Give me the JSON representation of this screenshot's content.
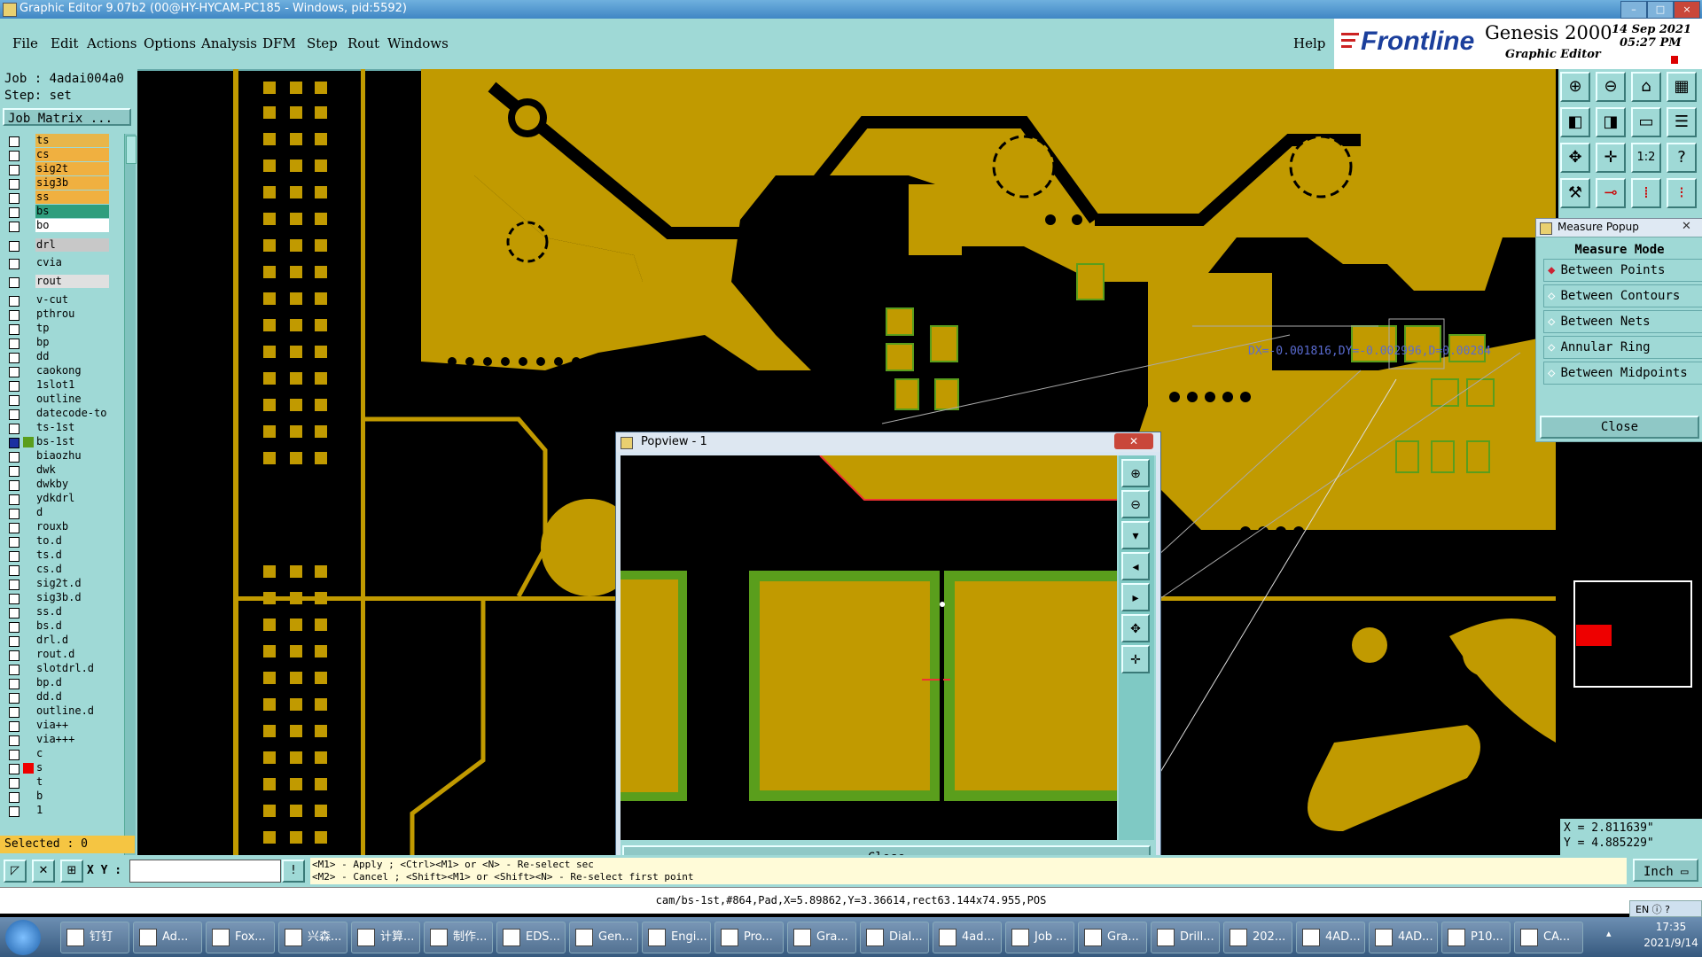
{
  "window": {
    "title": "Graphic Editor 9.07b2 (00@HY-HYCAM-PC185 - Windows, pid:5592)"
  },
  "menu": {
    "items": [
      "File",
      "Edit",
      "Actions",
      "Options",
      "Analysis",
      "DFM",
      "Step",
      "Rout",
      "Windows"
    ],
    "help": "Help"
  },
  "brand": {
    "logo": "Frontline",
    "product": "Genesis 2000",
    "subtitle": "Graphic Editor",
    "date": "14 Sep 2021",
    "time": "05:27 PM"
  },
  "job": {
    "job_line": "Job : 4adai004a0",
    "step_line": "Step: set",
    "matrix_button": "Job Matrix ..."
  },
  "layers": [
    {
      "name": "ts",
      "color": "#e8b64a"
    },
    {
      "name": "cs",
      "color": "#f0b040"
    },
    {
      "name": "sig2t",
      "color": "#f0b040"
    },
    {
      "name": "sig3b",
      "color": "#f0b040"
    },
    {
      "name": "ss",
      "color": "#f0b040"
    },
    {
      "name": "bs",
      "color": "#2e9e7e"
    },
    {
      "name": "bo",
      "color": "#ffffff"
    },
    {
      "name": "drl",
      "color": "#c8c8c8"
    },
    {
      "name": "cvia",
      "color": "#9fd9d6"
    },
    {
      "name": "rout",
      "color": "#e0e0e0"
    },
    {
      "name": "v-cut",
      "color": "#9fd9d6"
    },
    {
      "name": "pthrou",
      "color": "#9fd9d6"
    },
    {
      "name": "tp",
      "color": "#9fd9d6"
    },
    {
      "name": "bp",
      "color": "#9fd9d6"
    },
    {
      "name": "dd",
      "color": "#9fd9d6"
    },
    {
      "name": "caokong",
      "color": "#9fd9d6"
    },
    {
      "name": "1slot1",
      "color": "#9fd9d6"
    },
    {
      "name": "outline",
      "color": "#9fd9d6"
    },
    {
      "name": "datecode-to",
      "color": "#9fd9d6"
    },
    {
      "name": "ts-1st",
      "color": "#9fd9d6"
    },
    {
      "name": "bs-1st",
      "color": "#9fd9d6"
    },
    {
      "name": "biaozhu",
      "color": "#9fd9d6"
    },
    {
      "name": "dwk",
      "color": "#9fd9d6"
    },
    {
      "name": "dwkby",
      "color": "#9fd9d6"
    },
    {
      "name": "ydkdrl",
      "color": "#9fd9d6"
    },
    {
      "name": "d",
      "color": "#9fd9d6"
    },
    {
      "name": "rouxb",
      "color": "#9fd9d6"
    },
    {
      "name": "to.d",
      "color": "#9fd9d6"
    },
    {
      "name": "ts.d",
      "color": "#9fd9d6"
    },
    {
      "name": "cs.d",
      "color": "#9fd9d6"
    },
    {
      "name": "sig2t.d",
      "color": "#9fd9d6"
    },
    {
      "name": "sig3b.d",
      "color": "#9fd9d6"
    },
    {
      "name": "ss.d",
      "color": "#9fd9d6"
    },
    {
      "name": "bs.d",
      "color": "#9fd9d6"
    },
    {
      "name": "drl.d",
      "color": "#9fd9d6"
    },
    {
      "name": "rout.d",
      "color": "#9fd9d6"
    },
    {
      "name": "slotdrl.d",
      "color": "#9fd9d6"
    },
    {
      "name": "bp.d",
      "color": "#9fd9d6"
    },
    {
      "name": "dd.d",
      "color": "#9fd9d6"
    },
    {
      "name": "outline.d",
      "color": "#9fd9d6"
    },
    {
      "name": "via++",
      "color": "#9fd9d6"
    },
    {
      "name": "via+++",
      "color": "#9fd9d6"
    },
    {
      "name": "c",
      "color": "#9fd9d6"
    },
    {
      "name": "s",
      "color": "#9fd9d6"
    },
    {
      "name": "t",
      "color": "#9fd9d6"
    },
    {
      "name": "b",
      "color": "#9fd9d6"
    },
    {
      "name": "1",
      "color": "#9fd9d6"
    }
  ],
  "selected": "Selected : 0",
  "measure": {
    "title": "Measure Popup",
    "mode_label": "Measure Mode",
    "options": [
      "Between Points",
      "Between Contours",
      "Between Nets",
      "Annular Ring",
      "Between Midpoints"
    ],
    "active": "Between Points",
    "close": "Close",
    "readout": "DX=-0.001816,DY=-0.002996,D=0.00284"
  },
  "popview": {
    "title": "Popview - 1",
    "close": "Close"
  },
  "coords": {
    "x": "X = 2.811639\"",
    "y": "Y = 4.885229\""
  },
  "command": {
    "xy_label": "X Y :",
    "xy_value": "",
    "hint1": "<M1> - Apply  ; <Ctrl><M1> or <N> - Re-select sec",
    "hint2": "<M2> - Cancel ; <Shift><M1> or <Shift><N> - Re-select first point",
    "units": "Inch"
  },
  "status": "cam/bs-1st,#864,Pad,X=5.89862,Y=3.36614,rect63.144x74.955,POS",
  "taskbar": {
    "items": [
      "钉钉",
      "Ad...",
      "Fox...",
      "兴森...",
      "计算...",
      "制作...",
      "EDS...",
      "Gen...",
      "Engi...",
      "Pro...",
      "Gra...",
      "Dial...",
      "4ad...",
      "Job ...",
      "Gra...",
      "Drill...",
      "202...",
      "4AD...",
      "4AD...",
      "P10...",
      "CA..."
    ],
    "clock_time": "17:35",
    "clock_date": "2021/9/14",
    "ime": "EN"
  },
  "colors": {
    "panel": "#9fd9d6",
    "copper": "#c19a00",
    "green_outline": "#5a9e1c",
    "background": "#000000"
  }
}
